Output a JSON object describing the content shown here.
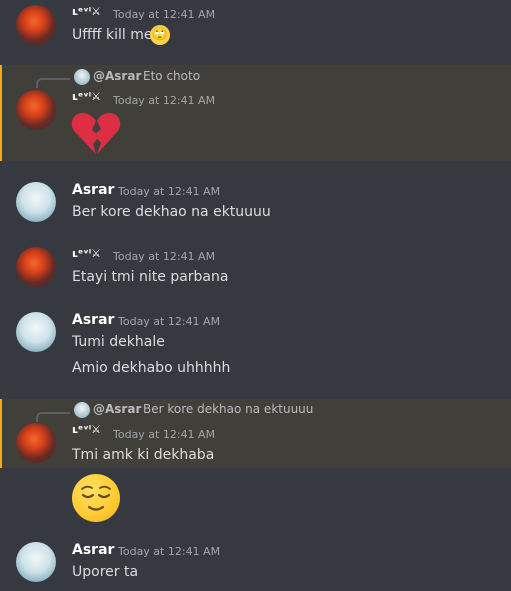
{
  "users": {
    "levi": "ʟᵉᵛⁱ⚔",
    "asrar": "Asrar"
  },
  "timestamp": "Today at 12:41 AM",
  "messages": [
    {
      "author": "levi",
      "text": "Uffff kill me"
    },
    {
      "author": "levi",
      "reply_to": "@Asrar",
      "reply_text": "Eto choto",
      "text": ""
    },
    {
      "author": "asrar",
      "text": "Ber kore dekhao na ektuuuu"
    },
    {
      "author": "levi",
      "text": "Etayi tmi nite parbana"
    },
    {
      "author": "asrar",
      "text": "Tumi dekhale",
      "text2": "Amio dekhabo uhhhhh"
    },
    {
      "author": "levi",
      "reply_to": "@Asrar",
      "reply_text": "Ber kore dekhao na ektuuuu",
      "text": "Tmi amk ki dekhaba"
    },
    {
      "author": "asrar",
      "text": "Uporer ta"
    }
  ],
  "colors": {
    "background": "#36393f",
    "highlight": "#413f3a",
    "mention_bar": "#faa61a",
    "heart": "#dd2e44"
  },
  "icons": [
    "rolling-eyes-emoji",
    "broken-heart-emoji",
    "relieved-face-emoji"
  ]
}
